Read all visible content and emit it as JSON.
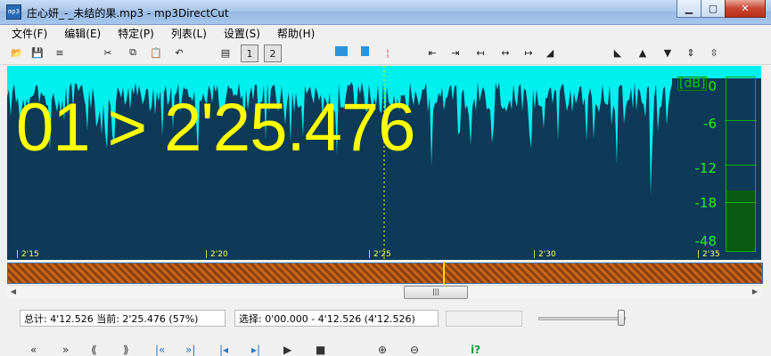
{
  "window": {
    "title": "庄心妍_-_未结的果.mp3 - mp3DirectCut",
    "icon_text": "mp3",
    "controls": [
      "minimize-icon",
      "maximize-icon",
      "close-icon"
    ]
  },
  "menu": [
    {
      "label": "文件(F)"
    },
    {
      "label": "编辑(E)"
    },
    {
      "label": "特定(P)"
    },
    {
      "label": "列表(L)"
    },
    {
      "label": "设置(S)"
    },
    {
      "label": "帮助(H)"
    }
  ],
  "toolbar": {
    "items": [
      {
        "name": "open-icon",
        "glyph": "📂"
      },
      {
        "name": "save-icon",
        "glyph": "💾"
      },
      {
        "name": "save-list-icon",
        "glyph": "≡"
      },
      {
        "name": "cut-icon",
        "glyph": "✂"
      },
      {
        "name": "copy-icon",
        "glyph": "⧉"
      },
      {
        "name": "paste-icon",
        "glyph": "📋"
      },
      {
        "name": "undo-icon",
        "glyph": "↶"
      },
      {
        "name": "page-icon",
        "glyph": "▤"
      },
      {
        "name": "page-1-icon",
        "glyph": "1"
      },
      {
        "name": "page-2-icon",
        "glyph": "2"
      },
      {
        "name": "set-begin-icon",
        "glyph": ""
      },
      {
        "name": "set-end-icon",
        "glyph": ""
      },
      {
        "name": "cue-icon",
        "glyph": "¦"
      },
      {
        "name": "sel-left-icon",
        "glyph": "⇤"
      },
      {
        "name": "sel-right-icon",
        "glyph": "⇥"
      },
      {
        "name": "move-left-icon",
        "glyph": "↤"
      },
      {
        "name": "move-both-icon",
        "glyph": "↔"
      },
      {
        "name": "move-right-icon",
        "glyph": "↦"
      },
      {
        "name": "fade-left-icon",
        "glyph": "◢"
      },
      {
        "name": "fade-right-icon",
        "glyph": "◣"
      },
      {
        "name": "fade-up-icon",
        "glyph": "▲"
      },
      {
        "name": "fade-down-icon",
        "glyph": "▼"
      },
      {
        "name": "normalize-icon",
        "glyph": "⇕"
      }
    ]
  },
  "wave": {
    "time_display": "01 > 2'25.476",
    "colors": {
      "background": "#0d3a57",
      "waveform": "#00f0f0",
      "text": "#ffff00",
      "meter": "#22ee22"
    },
    "ticks": [
      "2'15",
      "2'20",
      "2'25",
      "2'30",
      "2'35"
    ],
    "meter": {
      "unit": "[dB]",
      "labels": [
        "0",
        "-6",
        "-12",
        "-18",
        "-48"
      ],
      "level": 0.35
    }
  },
  "status": {
    "total": "总计: 4'12.526  当前: 2'25.476  (57%)",
    "selection": "选择: 0'00.000 - 4'12.526 (4'12.526)"
  },
  "transport": {
    "items": [
      {
        "name": "rewind-icon",
        "glyph": "«"
      },
      {
        "name": "forward-icon",
        "glyph": "»"
      },
      {
        "name": "fast-rewind-icon",
        "glyph": "⟪"
      },
      {
        "name": "fast-forward-icon",
        "glyph": "⟫"
      },
      {
        "name": "to-start-icon",
        "glyph": "|«"
      },
      {
        "name": "to-end-icon",
        "glyph": "»|"
      },
      {
        "name": "sel-start-icon",
        "glyph": "|◂"
      },
      {
        "name": "sel-end-icon",
        "glyph": "▸|"
      },
      {
        "name": "play-icon",
        "glyph": "▶"
      },
      {
        "name": "stop-icon",
        "glyph": "■"
      },
      {
        "name": "zoom-in-icon",
        "glyph": "⊕"
      },
      {
        "name": "zoom-out-icon",
        "glyph": "⊖"
      },
      {
        "name": "info-icon",
        "glyph": "i?"
      }
    ]
  }
}
